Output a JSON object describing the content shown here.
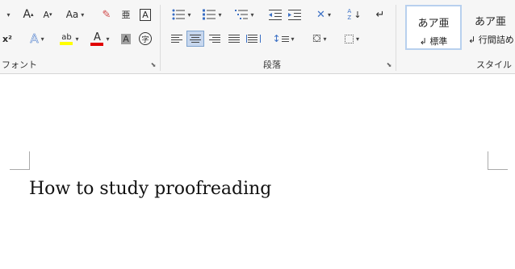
{
  "ribbon": {
    "font_group": {
      "label": "フォント",
      "grow_font": "A",
      "shrink_font": "A",
      "change_case": "Aa",
      "char_border": "A",
      "superscript": "x²",
      "text_effect": "A",
      "highlight": "ab",
      "font_color": "A",
      "char_shading": "A",
      "enclose_char": "字",
      "phonetic": "亜",
      "highlight_color": "#ffff00",
      "font_color_bar": "#e00000"
    },
    "paragraph_group": {
      "label": "段落",
      "sort": "A Z"
    },
    "styles_group": {
      "label": "スタイル",
      "cards": [
        {
          "sample": "あア亜",
          "name": "↲ 標準"
        },
        {
          "sample": "あア亜",
          "name": "↲ 行間詰め"
        }
      ]
    }
  },
  "document": {
    "text": "How to study proofreading"
  }
}
